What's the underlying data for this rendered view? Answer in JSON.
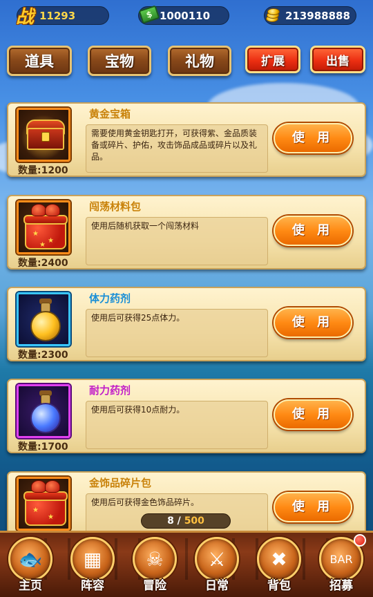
{
  "stats": {
    "power_icon": "战",
    "power": "11293",
    "cash": "1000110",
    "gold": "213988888"
  },
  "tabs": [
    {
      "label": "道具"
    },
    {
      "label": "宝物"
    },
    {
      "label": "礼物"
    }
  ],
  "actions": {
    "expand_label": "扩展",
    "sell_label": "出售"
  },
  "items": [
    {
      "name": "黄金宝箱",
      "name_color": "#c9820a",
      "desc": "需要使用黄金钥匙打开，可获得紫、金品质装备或碎片、护佑，攻击饰品成品或碎片以及礼品。",
      "qty": "数量:1200",
      "use_label": "使 用",
      "icon": "golden-chest-icon"
    },
    {
      "name": "闯荡材料包",
      "name_color": "#c9820a",
      "desc": "使用后随机获取一个闯荡材料",
      "qty": "数量:2400",
      "use_label": "使 用",
      "icon": "gift-box-icon"
    },
    {
      "name": "体力药剂",
      "name_color": "#1a8fd6",
      "desc": "使用后可获得25点体力。",
      "qty": "数量:2300",
      "use_label": "使 用",
      "icon": "stamina-potion-icon"
    },
    {
      "name": "耐力药剂",
      "name_color": "#c21fc8",
      "desc": "使用后可获得10点耐力。",
      "qty": "数量:1700",
      "use_label": "使 用",
      "icon": "endurance-potion-icon"
    },
    {
      "name": "金饰品碎片包",
      "name_color": "#c9820a",
      "desc": "使用后可获得金色饰品碎片。",
      "qty": "",
      "use_label": "使 用",
      "icon": "gift-box-icon"
    }
  ],
  "pager": {
    "current": "8",
    "separator": " / ",
    "total": "500"
  },
  "nav": [
    {
      "label": "主页",
      "icon": "home-icon"
    },
    {
      "label": "阵容",
      "icon": "lineup-icon"
    },
    {
      "label": "冒险",
      "icon": "skull-flag-icon"
    },
    {
      "label": "日常",
      "icon": "swords-icon"
    },
    {
      "label": "背包",
      "icon": "bag-icon"
    },
    {
      "label": "招募",
      "icon": "bar-icon"
    }
  ]
}
